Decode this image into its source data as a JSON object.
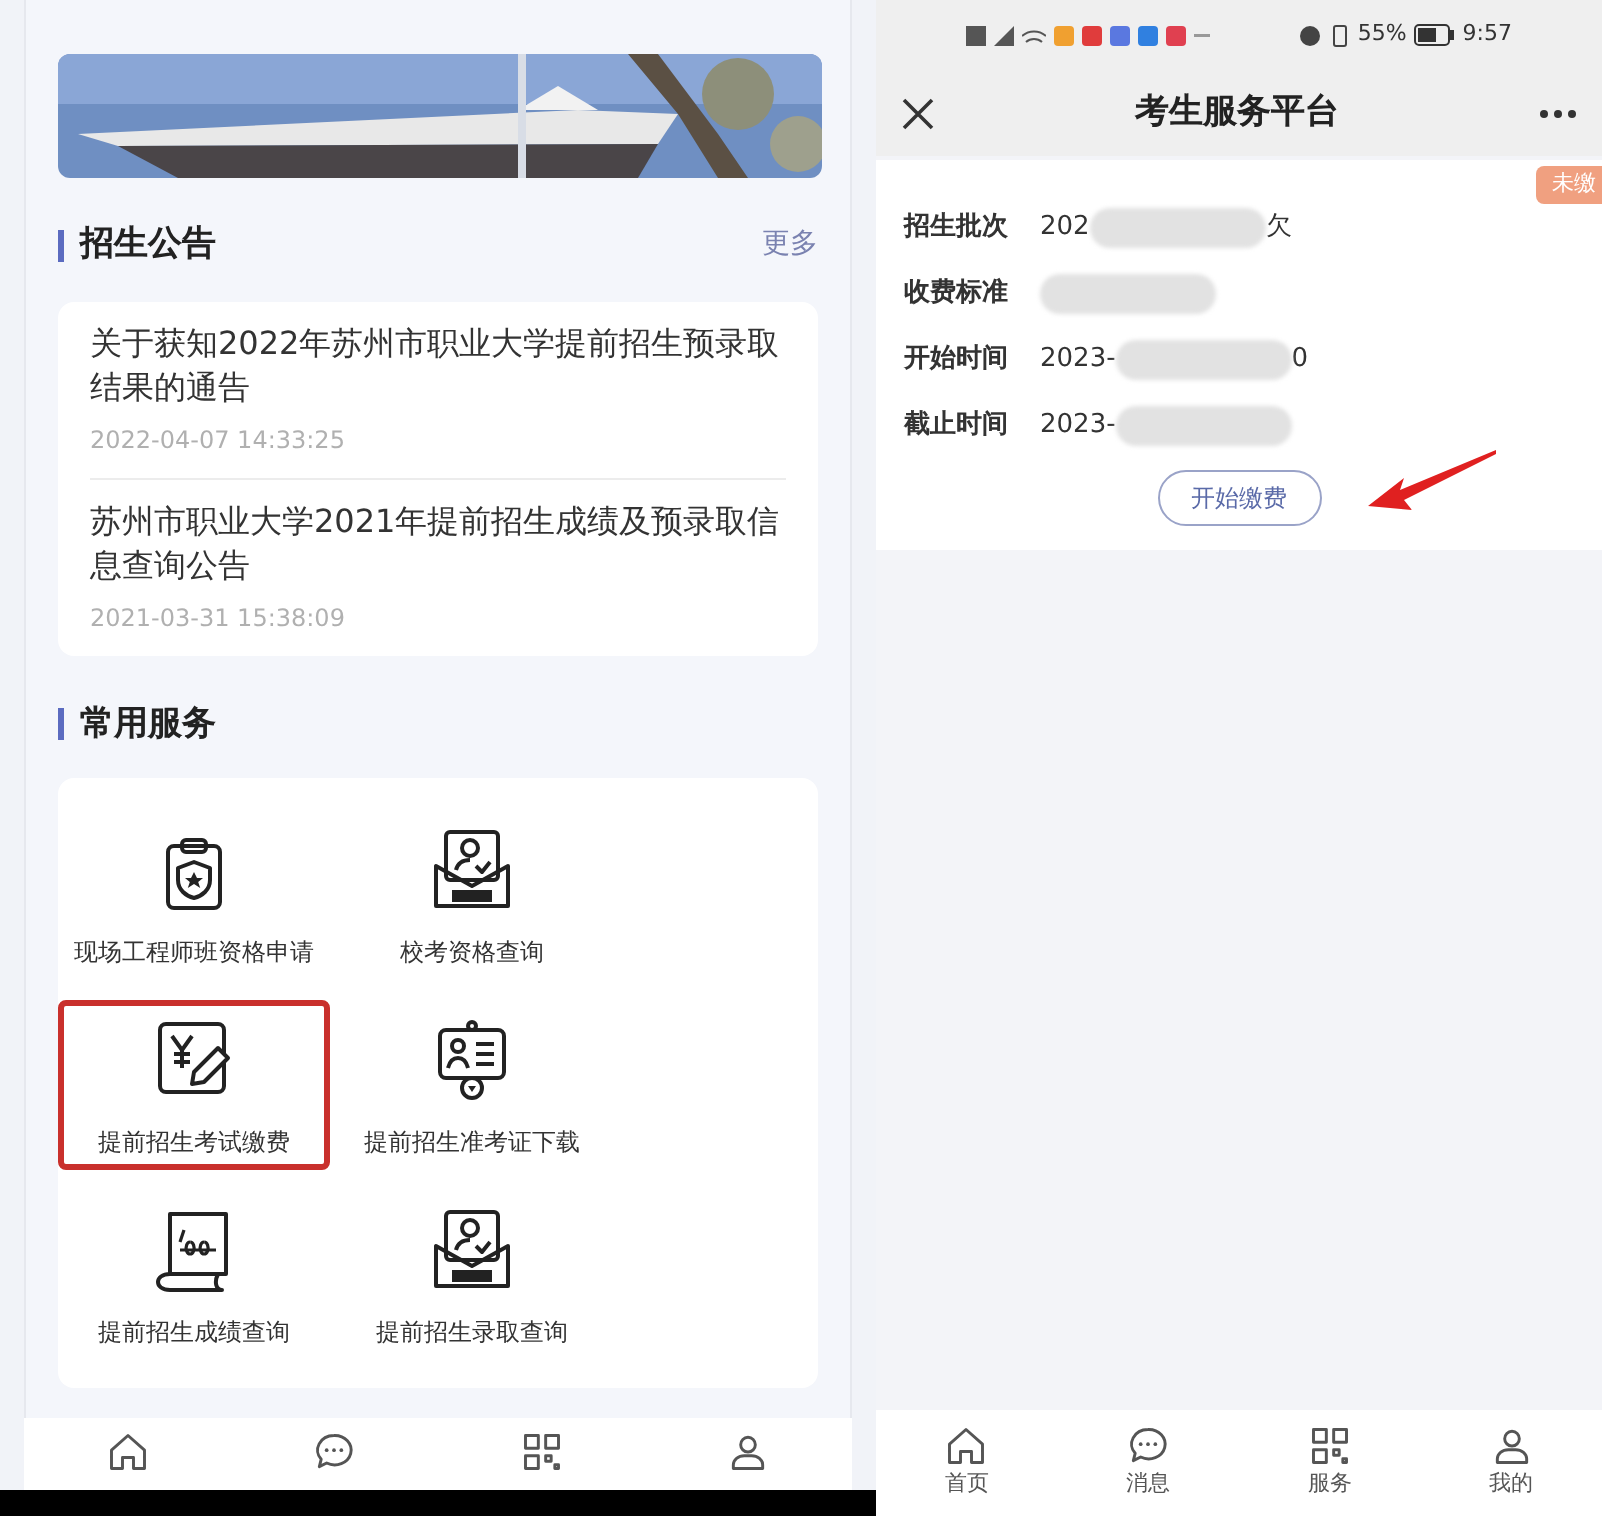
{
  "left_screen": {
    "notices": {
      "title": "招生公告",
      "more": "更多",
      "items": [
        {
          "title": "关于获知2022年苏州市职业大学提前招生预录取结果的通告",
          "time": "2022-04-07 14:33:25"
        },
        {
          "title": "苏州市职业大学2021年提前招生成绩及预录取信息查询公告",
          "time": "2021-03-31 15:38:09"
        }
      ]
    },
    "services": {
      "title": "常用服务",
      "items": [
        {
          "label": "现场工程师班资格申请",
          "kind": "clipboard",
          "highlighted": false
        },
        {
          "label": "校考资格查询",
          "kind": "envelope",
          "highlighted": false
        },
        {
          "label": "提前招生考试缴费",
          "kind": "payment",
          "highlighted": true
        },
        {
          "label": "提前招生准考证下载",
          "kind": "badge",
          "highlighted": false
        },
        {
          "label": "提前招生成绩查询",
          "kind": "scroll",
          "highlighted": false
        },
        {
          "label": "提前招生录取查询",
          "kind": "envelope",
          "highlighted": false
        }
      ]
    },
    "tab_bar": [
      {
        "kind": "home"
      },
      {
        "kind": "chat"
      },
      {
        "kind": "grid"
      },
      {
        "kind": "user"
      }
    ]
  },
  "right_screen": {
    "status_bar": {
      "battery": "55%",
      "time": "9:57"
    },
    "title": "考生服务平台",
    "status_badge": "未缴",
    "fields": [
      {
        "label": "招生批次",
        "value": "202",
        "suffix": "欠"
      },
      {
        "label": "收费标准"
      },
      {
        "label": "开始时间",
        "value": "2023-",
        "suffix": "0"
      },
      {
        "label": "截止时间",
        "value": "2023-"
      }
    ],
    "pay_button": "开始缴费",
    "tab_bar": [
      {
        "kind": "home",
        "label": "首页"
      },
      {
        "kind": "chat",
        "label": "消息"
      },
      {
        "kind": "grid",
        "label": "服务"
      },
      {
        "kind": "user",
        "label": "我的"
      }
    ]
  }
}
